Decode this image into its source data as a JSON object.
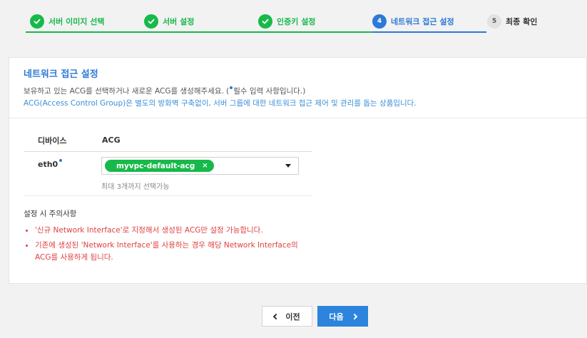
{
  "stepper": {
    "steps": [
      {
        "label": "서버 이미지 선택",
        "state": "done"
      },
      {
        "label": "서버 설정",
        "state": "done"
      },
      {
        "label": "인증키 설정",
        "state": "done"
      },
      {
        "label": "네트워크 접근 설정",
        "state": "active",
        "number": "4"
      },
      {
        "label": "최종 확인",
        "state": "pending",
        "number": "5"
      }
    ]
  },
  "section": {
    "title": "네트워크 접근 설정",
    "desc_prefix": "보유하고 있는 ACG를 선택하거나 새로운 ACG를 생성해주세요. (",
    "desc_suffix": "필수 입력 사항입니다.)",
    "desc_info": "ACG(Access Control Group)은 별도의 방화벽 구축없이, 서버 그룹에 대한 네트워크 접근 제어 및 관리를 돕는 상품입니다."
  },
  "table": {
    "headers": {
      "device": "디바이스",
      "acg": "ACG"
    },
    "rows": [
      {
        "device": "eth0",
        "tag": "myvpc-default-acg",
        "tag_remove": "×",
        "hint": "최대 3개까지 선택가능"
      }
    ]
  },
  "notes": {
    "title": "설정 시 주의사항",
    "items": [
      {
        "lines": [
          "'신규 Network Interface'로 지정해서 생성된 ACG만 설정 가능합니다."
        ]
      },
      {
        "lines": [
          "기존에 생성된 'Network Interface'를 사용하는 경우 해당 Network Interface의",
          "ACG를 사용하게 됩니다."
        ]
      }
    ]
  },
  "buttons": {
    "prev": "이전",
    "next": "다음"
  },
  "colors": {
    "green": "#17b94a",
    "blue": "#2c79d6",
    "red": "#e04040"
  }
}
